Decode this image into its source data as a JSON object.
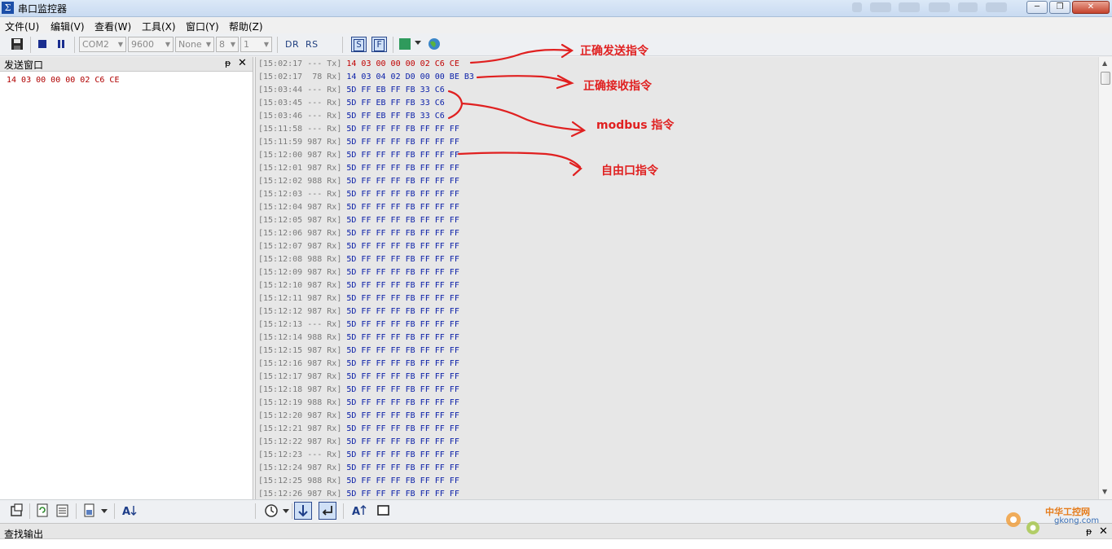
{
  "window": {
    "title": "串口监控器",
    "app_icon_glyph": "Σ"
  },
  "menu": [
    "文件(U)",
    "编辑(V)",
    "查看(W)",
    "工具(X)",
    "窗口(Y)",
    "帮助(Z)"
  ],
  "toolbar": {
    "port": "COM2",
    "baud": "9600",
    "parity": "None",
    "databits": "8",
    "stopbits": "1",
    "dr_label": "DR",
    "rs_label": "RS",
    "s_label": "S",
    "f_label": "F"
  },
  "send_window": {
    "title": "发送窗口",
    "pin_glyph": "ᵽ",
    "close_glyph": "✕",
    "content": "14 03 00 00 00 02 C6 CE"
  },
  "log": [
    {
      "time": "[15:02:17",
      "meta": "--- Tx]",
      "hex": "14 03 00 00 00 02 C6 CE",
      "dir": "tx"
    },
    {
      "time": "[15:02:17",
      "meta": " 78 Rx]",
      "hex": "14 03 04 02 D0 00 00 BE B3",
      "dir": "rx"
    },
    {
      "time": "[15:03:44",
      "meta": "--- Rx]",
      "hex": "5D FF EB FF FB 33 C6",
      "dir": "rx"
    },
    {
      "time": "[15:03:45",
      "meta": "--- Rx]",
      "hex": "5D FF EB FF FB 33 C6",
      "dir": "rx"
    },
    {
      "time": "[15:03:46",
      "meta": "--- Rx]",
      "hex": "5D FF EB FF FB 33 C6",
      "dir": "rx"
    },
    {
      "time": "[15:11:58",
      "meta": "--- Rx]",
      "hex": "5D FF FF FF FB FF FF FF",
      "dir": "rx"
    },
    {
      "time": "[15:11:59",
      "meta": "987 Rx]",
      "hex": "5D FF FF FF FB FF FF FF",
      "dir": "rx"
    },
    {
      "time": "[15:12:00",
      "meta": "987 Rx]",
      "hex": "5D FF FF FF FB FF FF FF",
      "dir": "rx"
    },
    {
      "time": "[15:12:01",
      "meta": "987 Rx]",
      "hex": "5D FF FF FF FB FF FF FF",
      "dir": "rx"
    },
    {
      "time": "[15:12:02",
      "meta": "988 Rx]",
      "hex": "5D FF FF FF FB FF FF FF",
      "dir": "rx"
    },
    {
      "time": "[15:12:03",
      "meta": "--- Rx]",
      "hex": "5D FF FF FF FB FF FF FF",
      "dir": "rx"
    },
    {
      "time": "[15:12:04",
      "meta": "987 Rx]",
      "hex": "5D FF FF FF FB FF FF FF",
      "dir": "rx"
    },
    {
      "time": "[15:12:05",
      "meta": "987 Rx]",
      "hex": "5D FF FF FF FB FF FF FF",
      "dir": "rx"
    },
    {
      "time": "[15:12:06",
      "meta": "987 Rx]",
      "hex": "5D FF FF FF FB FF FF FF",
      "dir": "rx"
    },
    {
      "time": "[15:12:07",
      "meta": "987 Rx]",
      "hex": "5D FF FF FF FB FF FF FF",
      "dir": "rx"
    },
    {
      "time": "[15:12:08",
      "meta": "988 Rx]",
      "hex": "5D FF FF FF FB FF FF FF",
      "dir": "rx"
    },
    {
      "time": "[15:12:09",
      "meta": "987 Rx]",
      "hex": "5D FF FF FF FB FF FF FF",
      "dir": "rx"
    },
    {
      "time": "[15:12:10",
      "meta": "987 Rx]",
      "hex": "5D FF FF FF FB FF FF FF",
      "dir": "rx"
    },
    {
      "time": "[15:12:11",
      "meta": "987 Rx]",
      "hex": "5D FF FF FF FB FF FF FF",
      "dir": "rx"
    },
    {
      "time": "[15:12:12",
      "meta": "987 Rx]",
      "hex": "5D FF FF FF FB FF FF FF",
      "dir": "rx"
    },
    {
      "time": "[15:12:13",
      "meta": "--- Rx]",
      "hex": "5D FF FF FF FB FF FF FF",
      "dir": "rx"
    },
    {
      "time": "[15:12:14",
      "meta": "988 Rx]",
      "hex": "5D FF FF FF FB FF FF FF",
      "dir": "rx"
    },
    {
      "time": "[15:12:15",
      "meta": "987 Rx]",
      "hex": "5D FF FF FF FB FF FF FF",
      "dir": "rx"
    },
    {
      "time": "[15:12:16",
      "meta": "987 Rx]",
      "hex": "5D FF FF FF FB FF FF FF",
      "dir": "rx"
    },
    {
      "time": "[15:12:17",
      "meta": "987 Rx]",
      "hex": "5D FF FF FF FB FF FF FF",
      "dir": "rx"
    },
    {
      "time": "[15:12:18",
      "meta": "987 Rx]",
      "hex": "5D FF FF FF FB FF FF FF",
      "dir": "rx"
    },
    {
      "time": "[15:12:19",
      "meta": "988 Rx]",
      "hex": "5D FF FF FF FB FF FF FF",
      "dir": "rx"
    },
    {
      "time": "[15:12:20",
      "meta": "987 Rx]",
      "hex": "5D FF FF FF FB FF FF FF",
      "dir": "rx"
    },
    {
      "time": "[15:12:21",
      "meta": "987 Rx]",
      "hex": "5D FF FF FF FB FF FF FF",
      "dir": "rx"
    },
    {
      "time": "[15:12:22",
      "meta": "987 Rx]",
      "hex": "5D FF FF FF FB FF FF FF",
      "dir": "rx"
    },
    {
      "time": "[15:12:23",
      "meta": "--- Rx]",
      "hex": "5D FF FF FF FB FF FF FF",
      "dir": "rx"
    },
    {
      "time": "[15:12:24",
      "meta": "987 Rx]",
      "hex": "5D FF FF FF FB FF FF FF",
      "dir": "rx"
    },
    {
      "time": "[15:12:25",
      "meta": "988 Rx]",
      "hex": "5D FF FF FF FB FF FF FF",
      "dir": "rx"
    },
    {
      "time": "[15:12:26",
      "meta": "987 Rx]",
      "hex": "5D FF FF FF FB FF FF FF",
      "dir": "rx"
    }
  ],
  "annotations": {
    "correct_send": "正确发送指令",
    "correct_receive": "正确接收指令",
    "modbus": "modbus 指令",
    "free_port": "自由口指令"
  },
  "find_output": {
    "title": "查找输出"
  },
  "watermark": {
    "line1": "中华工控网",
    "line2": "gkong.com"
  },
  "colors": {
    "tx_hex": "#c00000",
    "rx_hex": "#0a1fa8",
    "annotation": "#e02020"
  }
}
